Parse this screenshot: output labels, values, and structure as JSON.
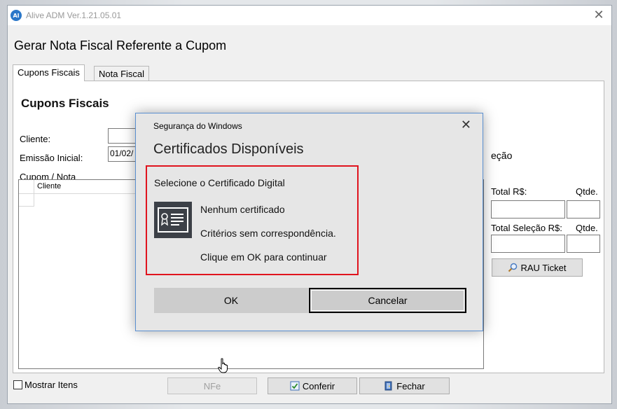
{
  "window": {
    "title": "Alive ADM Ver.1.21.05.01",
    "icon_text": "Al",
    "close_glyph": "✕",
    "heading": "Gerar Nota Fiscal Referente a Cupom"
  },
  "tabs": [
    {
      "label": "Cupons Fiscais",
      "active": true
    },
    {
      "label": "Nota Fiscal",
      "active": false
    }
  ],
  "panel": {
    "section_title": "Cupons Fiscais",
    "cliente_label": "Cliente:",
    "emissao_label": "Emissão Inicial:",
    "emissao_value": "01/02/",
    "cupom_label": "Cupom / Nota",
    "selecao_partial": "eção",
    "grid_columns": [
      "Cliente"
    ],
    "total_label": "Total R$:",
    "qtde_label": "Qtde.",
    "total_selecao_label": "Total Seleção R$:",
    "qtde2_label": "Qtde.",
    "rau_button": "RAU Ticket"
  },
  "footer": {
    "mostrar_itens": "Mostrar Itens",
    "nfe_button": "NFe",
    "conferir_button": "Conferir",
    "fechar_button": "Fechar"
  },
  "dialog": {
    "title": "Segurança do Windows",
    "close_glyph": "✕",
    "heading": "Certificados Disponíveis",
    "subheading": "Selecione o Certificado Digital",
    "cert_name": "Nenhum certificado",
    "cert_desc": "Critérios sem correspondência.",
    "hint": "Clique em OK para continuar",
    "ok_button": "OK",
    "cancel_button": "Cancelar"
  },
  "colors": {
    "highlight_border": "#e0141e",
    "dialog_border": "#5a8fd0",
    "app_icon": "#2a77c9"
  },
  "icons": [
    "app-icon",
    "close-icon",
    "certificate-icon",
    "search-icon",
    "check-icon",
    "door-icon",
    "hand-cursor-icon"
  ]
}
